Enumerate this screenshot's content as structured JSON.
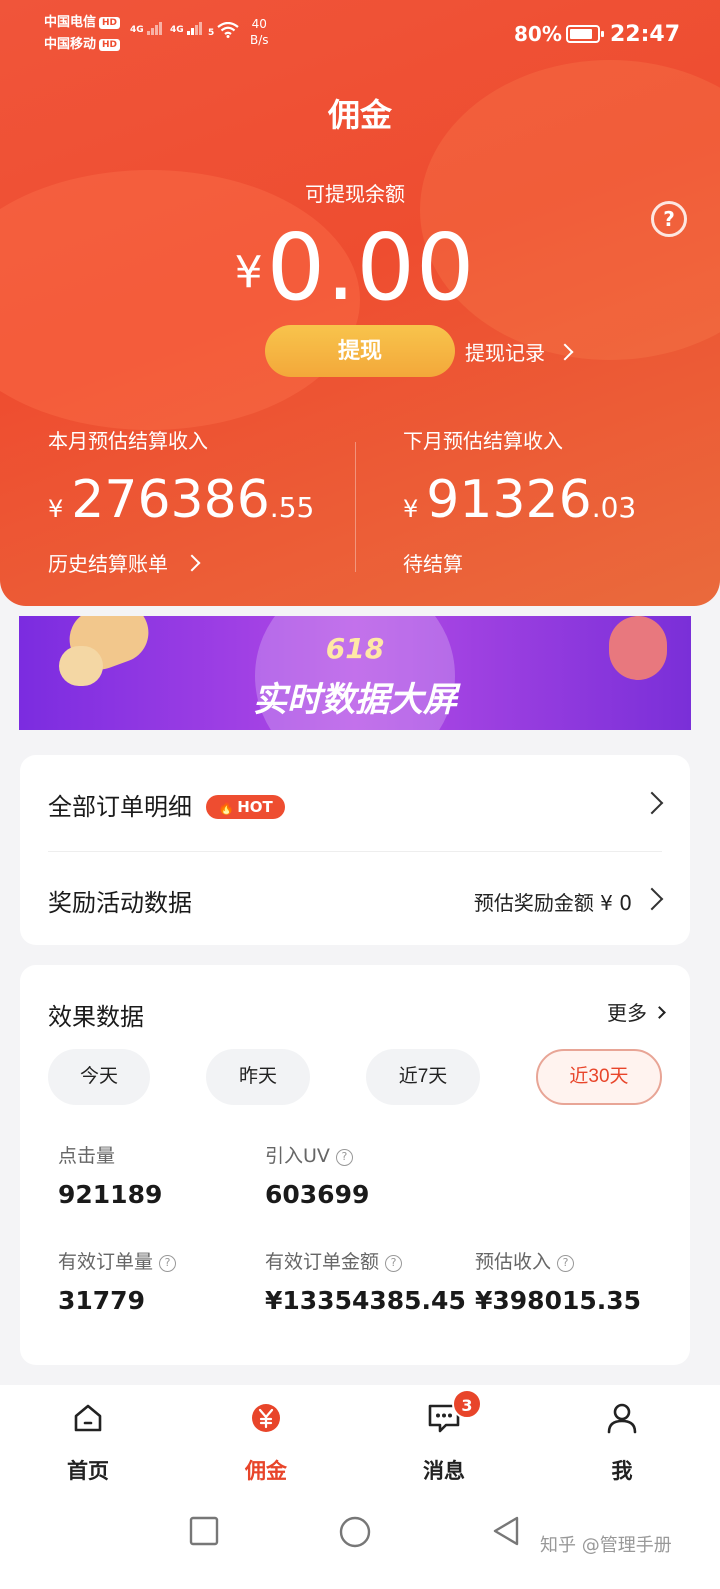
{
  "status_bar": {
    "carrier1": "中国电信",
    "carrier2": "中国移动",
    "hd": "HD",
    "sig1": "4G",
    "sig2": "4G",
    "sig3": "5",
    "net_speed_value": "40",
    "net_speed_unit": "B/s",
    "battery": "80%",
    "time": "22:47"
  },
  "header": {
    "title": "佣金"
  },
  "balance": {
    "label": "可提现余额",
    "currency": "¥",
    "amount": "0.00",
    "withdraw_label": "提现",
    "record_label": "提现记录"
  },
  "this_month": {
    "label": "本月预估结算收入",
    "currency": "¥",
    "int": "276386",
    "dec": ".55",
    "footer": "历史结算账单"
  },
  "next_month": {
    "label": "下月预估结算收入",
    "currency": "¥",
    "int": "91326",
    "dec": ".03",
    "footer": "待结算"
  },
  "banner": {
    "line1": "618",
    "line2": "实时数据大屏"
  },
  "orders": {
    "all_orders": "全部订单明细",
    "hot_badge": "HOT",
    "rewards": "奖励活动数据",
    "rewards_value": "预估奖励金额 ¥ 0"
  },
  "performance": {
    "title": "效果数据",
    "more": "更多",
    "tabs": [
      "今天",
      "昨天",
      "近7天",
      "近30天"
    ],
    "active_tab_index": 3,
    "metrics": [
      {
        "label": "点击量",
        "value": "921189"
      },
      {
        "label": "引入UV",
        "value": "603699"
      },
      {
        "label": "有效订单量",
        "value": "31779"
      },
      {
        "label": "有效订单金额",
        "value": "¥13354385.45"
      },
      {
        "label": "预估收入",
        "value": "¥398015.35"
      }
    ]
  },
  "tabbar": {
    "items": [
      "首页",
      "佣金",
      "消息",
      "我"
    ],
    "active_index": 1,
    "message_badge": "3"
  },
  "watermark": "知乎 @管理手册",
  "colors": {
    "brand": "#ee4d30",
    "accent_button": "#f3a83a",
    "active_text": "#e8452a"
  }
}
